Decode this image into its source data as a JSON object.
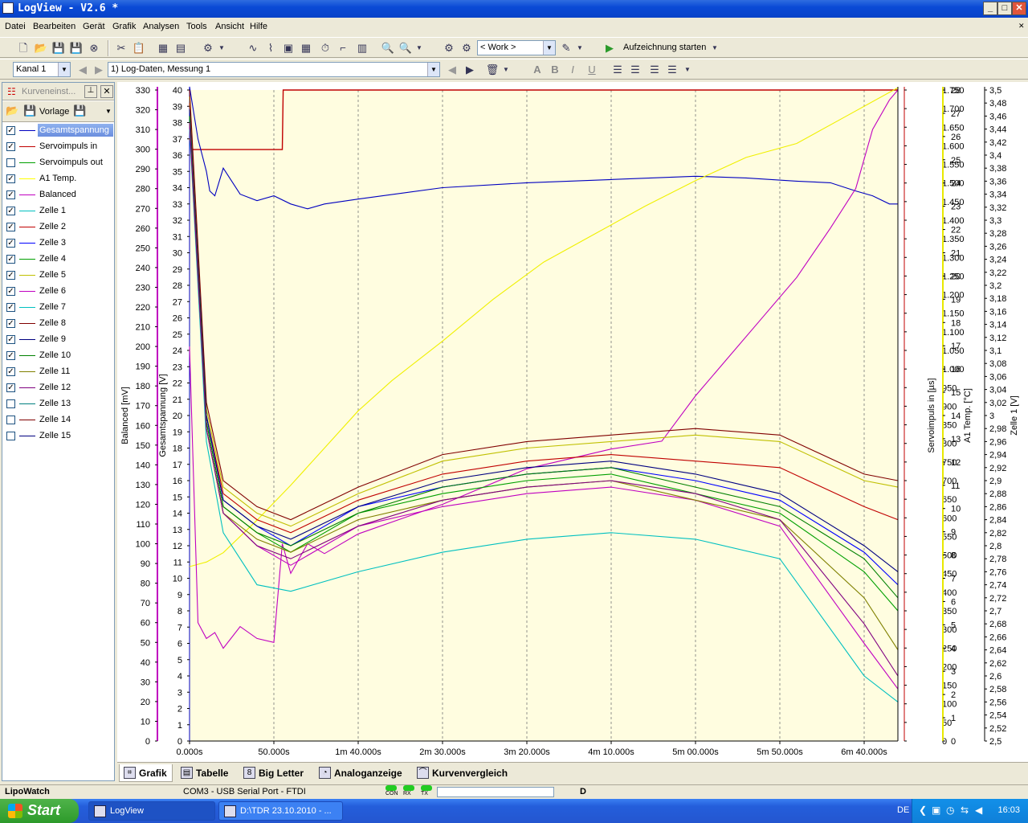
{
  "window": {
    "title": "LogView - V2.6 *",
    "min": "_",
    "max": "□",
    "close": "✕",
    "restore": "✕"
  },
  "menu": [
    "Datei",
    "Bearbeiten",
    "Gerät",
    "Grafik",
    "Analysen",
    "Tools",
    "Ansicht",
    "Hilfe"
  ],
  "toolbar1": {
    "profile_combo": "< Work >",
    "record_label": "Aufzeichnung starten"
  },
  "toolbar2": {
    "channel_combo": "Kanal 1",
    "dataset_combo": "1) Log-Daten, Messung 1",
    "text_format": [
      "A",
      "B",
      "I",
      "U"
    ]
  },
  "left_panel": {
    "title": "Kurveneinst...",
    "template_label": "Vorlage",
    "curves": [
      {
        "label": "Gesamtspannung",
        "checked": true,
        "color": "#0000c0",
        "selected": true
      },
      {
        "label": "Servoimpuls in",
        "checked": true,
        "color": "#c00000"
      },
      {
        "label": "Servoimpuls out",
        "checked": false,
        "color": "#00a000"
      },
      {
        "label": "A1 Temp.",
        "checked": true,
        "color": "#ffff00"
      },
      {
        "label": "Balanced",
        "checked": true,
        "color": "#c000c0"
      },
      {
        "label": "Zelle 1",
        "checked": true,
        "color": "#00c0c0"
      },
      {
        "label": "Zelle 2",
        "checked": true,
        "color": "#c00000"
      },
      {
        "label": "Zelle 3",
        "checked": true,
        "color": "#0000ff"
      },
      {
        "label": "Zelle 4",
        "checked": true,
        "color": "#00a000"
      },
      {
        "label": "Zelle 5",
        "checked": true,
        "color": "#c0c000"
      },
      {
        "label": "Zelle 6",
        "checked": true,
        "color": "#c000c0"
      },
      {
        "label": "Zelle 7",
        "checked": true,
        "color": "#00c0c0"
      },
      {
        "label": "Zelle 8",
        "checked": true,
        "color": "#800000"
      },
      {
        "label": "Zelle 9",
        "checked": true,
        "color": "#000080"
      },
      {
        "label": "Zelle 10",
        "checked": true,
        "color": "#008000"
      },
      {
        "label": "Zelle 11",
        "checked": true,
        "color": "#808000"
      },
      {
        "label": "Zelle 12",
        "checked": true,
        "color": "#800080"
      },
      {
        "label": "Zelle 13",
        "checked": false,
        "color": "#008080"
      },
      {
        "label": "Zelle 14",
        "checked": false,
        "color": "#800000"
      },
      {
        "label": "Zelle 15",
        "checked": false,
        "color": "#000080"
      }
    ]
  },
  "bottom_tabs": [
    "Grafik",
    "Tabelle",
    "Big Letter",
    "Analoganzeige",
    "Kurvenvergleich"
  ],
  "status": {
    "app": "LipoWatch",
    "port": "COM3 - USB Serial Port - FTDI",
    "leds": [
      "CON",
      "RX",
      "TX"
    ],
    "mode": "D"
  },
  "taskbar": {
    "start": "Start",
    "tasks": [
      "LogView",
      "D:\\TDR 23.10.2010 - ..."
    ],
    "lang": "DE",
    "time": "16:03"
  },
  "chart_data": {
    "type": "line",
    "background": "#fffde0",
    "x_ticks": [
      "0.000s",
      "50.000s",
      "1m 40.000s",
      "2m 30.000s",
      "3m 20.000s",
      "4m 10.000s",
      "5m 00.000s",
      "5m 50.000s",
      "6m 40.000s"
    ],
    "xlim_s": [
      0,
      420
    ],
    "axes": [
      {
        "label": "Balanced [mV]",
        "side": "left",
        "min": 0,
        "max": 330,
        "step": 10,
        "color": "#c000c0"
      },
      {
        "label": "Gesamtspannung [V]",
        "side": "left",
        "min": 0,
        "max": 40,
        "step": 1,
        "color": "#0000c0",
        "top_tick": 41
      },
      {
        "label": "Servoimpuls in [µs]",
        "side": "right",
        "min": 0,
        "max": 1750,
        "step": 50,
        "color": "#c00000",
        "tick_labels": [
          "0",
          "50",
          "100",
          "150",
          "200",
          "250",
          "300",
          "350",
          "400",
          "450",
          "500",
          "550",
          "600",
          "650",
          "700",
          "750",
          "800",
          "850",
          "900",
          "950",
          "1.000",
          "1.050",
          "1.100",
          "1.150",
          "1.200",
          "1.250",
          "1.300",
          "1.350",
          "1.400",
          "1.450",
          "1.500",
          "1.550",
          "1.600",
          "1.650",
          "1.700",
          "1.750"
        ]
      },
      {
        "label": "A1 Temp. [°C]",
        "side": "right",
        "min": 0,
        "max": 28,
        "step": 1,
        "color": "#e8e800"
      },
      {
        "label": "Zelle 1 [V]",
        "side": "right",
        "min": 2.5,
        "max": 3.5,
        "step": 0.02,
        "color": "#000000",
        "tick_labels": [
          "2,5",
          "2,52",
          "2,54",
          "2,56",
          "2,58",
          "2,6",
          "2,62",
          "2,64",
          "2,66",
          "2,68",
          "2,7",
          "2,72",
          "2,74",
          "2,76",
          "2,78",
          "2,8",
          "2,82",
          "2,84",
          "2,86",
          "2,88",
          "2,9",
          "2,92",
          "2,94",
          "2,96",
          "2,98",
          "3",
          "3,02",
          "3,04",
          "3,06",
          "3,08",
          "3,1",
          "3,12",
          "3,14",
          "3,16",
          "3,18",
          "3,2",
          "3,22",
          "3,24",
          "3,26",
          "3,28",
          "3,3",
          "3,32",
          "3,34",
          "3,36",
          "3,38",
          "3,4",
          "3,42",
          "3,44",
          "3,46",
          "3,48",
          "3,5"
        ]
      }
    ],
    "series": [
      {
        "name": "Servoimpuls in",
        "axis": 2,
        "color": "#c00000",
        "x": [
          0,
          2,
          55,
          55.5,
          420
        ],
        "y": [
          1620,
          1590,
          1590,
          1750,
          1750
        ]
      },
      {
        "name": "Gesamtspannung",
        "axis": 1,
        "color": "#0000c0",
        "x": [
          0,
          5,
          10,
          12,
          15,
          20,
          30,
          40,
          50,
          60,
          70,
          80,
          100,
          150,
          200,
          250,
          300,
          330,
          360,
          380,
          395,
          405,
          415,
          420
        ],
        "y": [
          40.2,
          37,
          35,
          33.8,
          33.5,
          35.2,
          33.6,
          33.2,
          33.5,
          33,
          32.7,
          33,
          33.3,
          34,
          34.3,
          34.5,
          34.7,
          34.6,
          34.4,
          34.3,
          33.8,
          33.5,
          33,
          33
        ]
      },
      {
        "name": "A1 Temp.",
        "axis": 3,
        "color": "#f0f000",
        "x": [
          0,
          10,
          20,
          40,
          60,
          80,
          100,
          120,
          150,
          180,
          210,
          240,
          270,
          300,
          330,
          360,
          390,
          420
        ],
        "y": [
          7.5,
          7.7,
          8.1,
          9.5,
          11,
          12.6,
          14.2,
          15.5,
          17.2,
          19,
          20.6,
          21.8,
          23,
          24.1,
          25.1,
          25.7,
          26.9,
          28.1
        ]
      },
      {
        "name": "Balanced",
        "axis": 0,
        "color": "#c000c0",
        "x": [
          0,
          5,
          10,
          15,
          20,
          30,
          40,
          50,
          55,
          60,
          70,
          80,
          100,
          150,
          200,
          250,
          280,
          300,
          320,
          340,
          360,
          380,
          395,
          405,
          415,
          420
        ],
        "y": [
          200,
          60,
          52,
          55,
          47,
          58,
          52,
          50,
          100,
          85,
          100,
          95,
          105,
          120,
          138,
          148,
          152,
          175,
          195,
          215,
          235,
          260,
          280,
          310,
          325,
          330
        ]
      },
      {
        "name": "Zelle 1",
        "axis": 4,
        "color": "#00c0c0",
        "x": [
          0,
          10,
          20,
          40,
          60,
          100,
          150,
          200,
          250,
          300,
          350,
          400,
          420
        ],
        "y": [
          3.44,
          2.96,
          2.82,
          2.74,
          2.73,
          2.76,
          2.79,
          2.81,
          2.82,
          2.81,
          2.78,
          2.6,
          2.56
        ]
      },
      {
        "name": "Zelle 2",
        "axis": 4,
        "color": "#c00000",
        "x": [
          0,
          10,
          20,
          40,
          60,
          100,
          150,
          200,
          250,
          300,
          350,
          400,
          420
        ],
        "y": [
          3.48,
          3.0,
          2.88,
          2.84,
          2.82,
          2.87,
          2.91,
          2.93,
          2.94,
          2.93,
          2.92,
          2.86,
          2.84
        ]
      },
      {
        "name": "Zelle 3",
        "axis": 4,
        "color": "#0000ff",
        "x": [
          0,
          10,
          20,
          40,
          60,
          100,
          150,
          200,
          250,
          300,
          350,
          400,
          420
        ],
        "y": [
          3.47,
          3.0,
          2.87,
          2.83,
          2.8,
          2.86,
          2.89,
          2.91,
          2.92,
          2.9,
          2.87,
          2.79,
          2.74
        ]
      },
      {
        "name": "Zelle 4",
        "axis": 4,
        "color": "#00a000",
        "x": [
          0,
          10,
          20,
          40,
          60,
          100,
          150,
          200,
          250,
          300,
          350,
          400,
          420
        ],
        "y": [
          3.46,
          2.99,
          2.86,
          2.82,
          2.79,
          2.85,
          2.88,
          2.9,
          2.91,
          2.88,
          2.85,
          2.76,
          2.7
        ]
      },
      {
        "name": "Zelle 5",
        "axis": 4,
        "color": "#c0c000",
        "x": [
          0,
          10,
          20,
          40,
          60,
          100,
          150,
          200,
          250,
          300,
          350,
          400,
          420
        ],
        "y": [
          3.49,
          3.01,
          2.89,
          2.85,
          2.83,
          2.88,
          2.93,
          2.95,
          2.96,
          2.97,
          2.96,
          2.9,
          2.89
        ]
      },
      {
        "name": "Zelle 6",
        "axis": 4,
        "color": "#c000c0",
        "x": [
          0,
          10,
          20,
          40,
          60,
          100,
          150,
          200,
          250,
          300,
          350,
          400,
          420
        ],
        "y": [
          3.45,
          2.98,
          2.85,
          2.8,
          2.77,
          2.83,
          2.86,
          2.88,
          2.89,
          2.87,
          2.83,
          2.65,
          2.58
        ]
      },
      {
        "name": "Zelle 8",
        "axis": 4,
        "color": "#800000",
        "x": [
          0,
          10,
          20,
          40,
          60,
          100,
          150,
          200,
          250,
          300,
          350,
          400,
          420
        ],
        "y": [
          3.5,
          3.02,
          2.9,
          2.86,
          2.84,
          2.89,
          2.94,
          2.96,
          2.97,
          2.98,
          2.97,
          2.91,
          2.9
        ]
      },
      {
        "name": "Zelle 9",
        "axis": 4,
        "color": "#000080",
        "x": [
          0,
          10,
          20,
          40,
          60,
          100,
          150,
          200,
          250,
          300,
          350,
          400,
          420
        ],
        "y": [
          3.47,
          3.0,
          2.87,
          2.83,
          2.81,
          2.86,
          2.9,
          2.92,
          2.93,
          2.91,
          2.88,
          2.8,
          2.76
        ]
      },
      {
        "name": "Zelle 10",
        "axis": 4,
        "color": "#008000",
        "x": [
          0,
          10,
          20,
          40,
          60,
          100,
          150,
          200,
          250,
          300,
          350,
          400,
          420
        ],
        "y": [
          3.46,
          2.99,
          2.86,
          2.82,
          2.8,
          2.85,
          2.89,
          2.91,
          2.92,
          2.89,
          2.86,
          2.78,
          2.72
        ]
      },
      {
        "name": "Zelle 11",
        "axis": 4,
        "color": "#808000",
        "x": [
          0,
          10,
          20,
          40,
          60,
          100,
          150,
          200,
          250,
          300,
          350,
          400,
          420
        ],
        "y": [
          3.45,
          2.98,
          2.85,
          2.81,
          2.79,
          2.84,
          2.87,
          2.89,
          2.9,
          2.87,
          2.84,
          2.72,
          2.64
        ]
      },
      {
        "name": "Zelle 12",
        "axis": 4,
        "color": "#800080",
        "x": [
          0,
          10,
          20,
          40,
          60,
          100,
          150,
          200,
          250,
          300,
          350,
          400,
          420
        ],
        "y": [
          3.45,
          2.98,
          2.85,
          2.8,
          2.78,
          2.83,
          2.87,
          2.89,
          2.9,
          2.88,
          2.84,
          2.68,
          2.6
        ]
      }
    ]
  }
}
